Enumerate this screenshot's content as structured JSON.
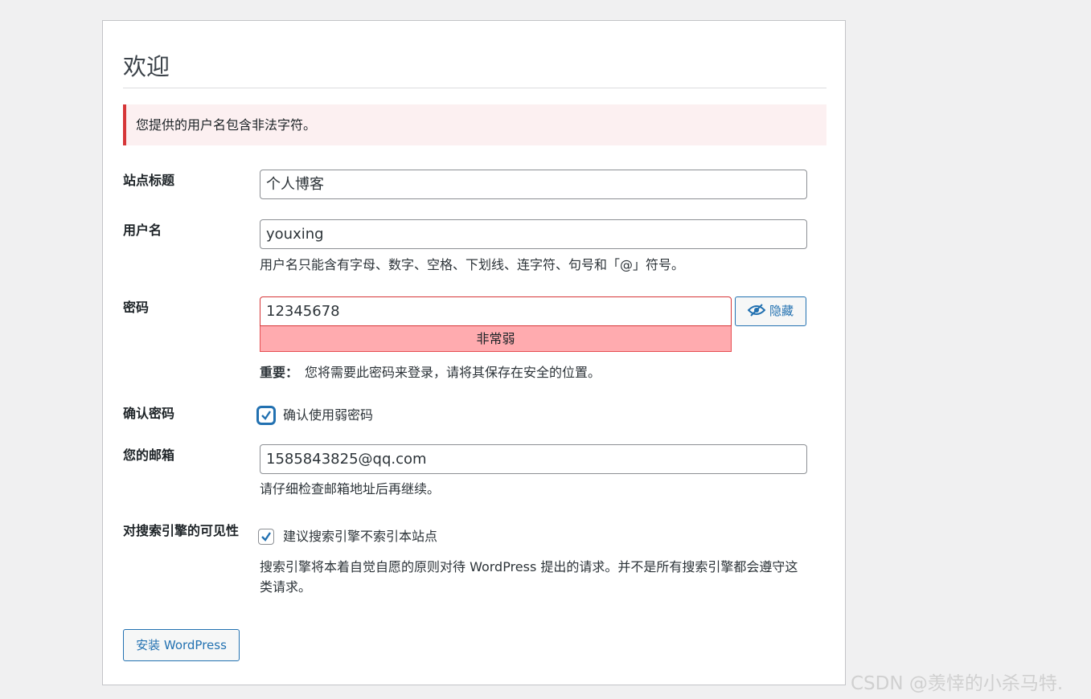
{
  "page": {
    "title": "欢迎"
  },
  "error": {
    "message": "您提供的用户名包含非法字符。"
  },
  "form": {
    "site_title": {
      "label": "站点标题",
      "value": "个人博客"
    },
    "username": {
      "label": "用户名",
      "value": "youxing",
      "hint": "用户名只能含有字母、数字、空格、下划线、连字符、句号和「@」符号。"
    },
    "password": {
      "label": "密码",
      "value": "12345678",
      "strength": "非常弱",
      "hide_label": "隐藏",
      "important_label": "重要：",
      "important_text": "您将需要此密码来登录，请将其保存在安全的位置。"
    },
    "confirm": {
      "label": "确认密码",
      "checkbox_label": "确认使用弱密码",
      "checked": true
    },
    "email": {
      "label": "您的邮箱",
      "value": "1585843825@qq.com",
      "hint": "请仔细检查邮箱地址后再继续。"
    },
    "visibility": {
      "label": "对搜索引擎的可见性",
      "checkbox_label": "建议搜索引擎不索引本站点",
      "checked": true,
      "hint": "搜索引擎将本着自觉自愿的原则对待 WordPress 提出的请求。并不是所有搜索引擎都会遵守这类请求。"
    },
    "submit_label": "安装 WordPress"
  },
  "watermark": "CSDN @羡悻的小杀马特.",
  "colors": {
    "accent": "#2271b1",
    "error": "#d63638",
    "strength_bg": "#ffabaf"
  }
}
